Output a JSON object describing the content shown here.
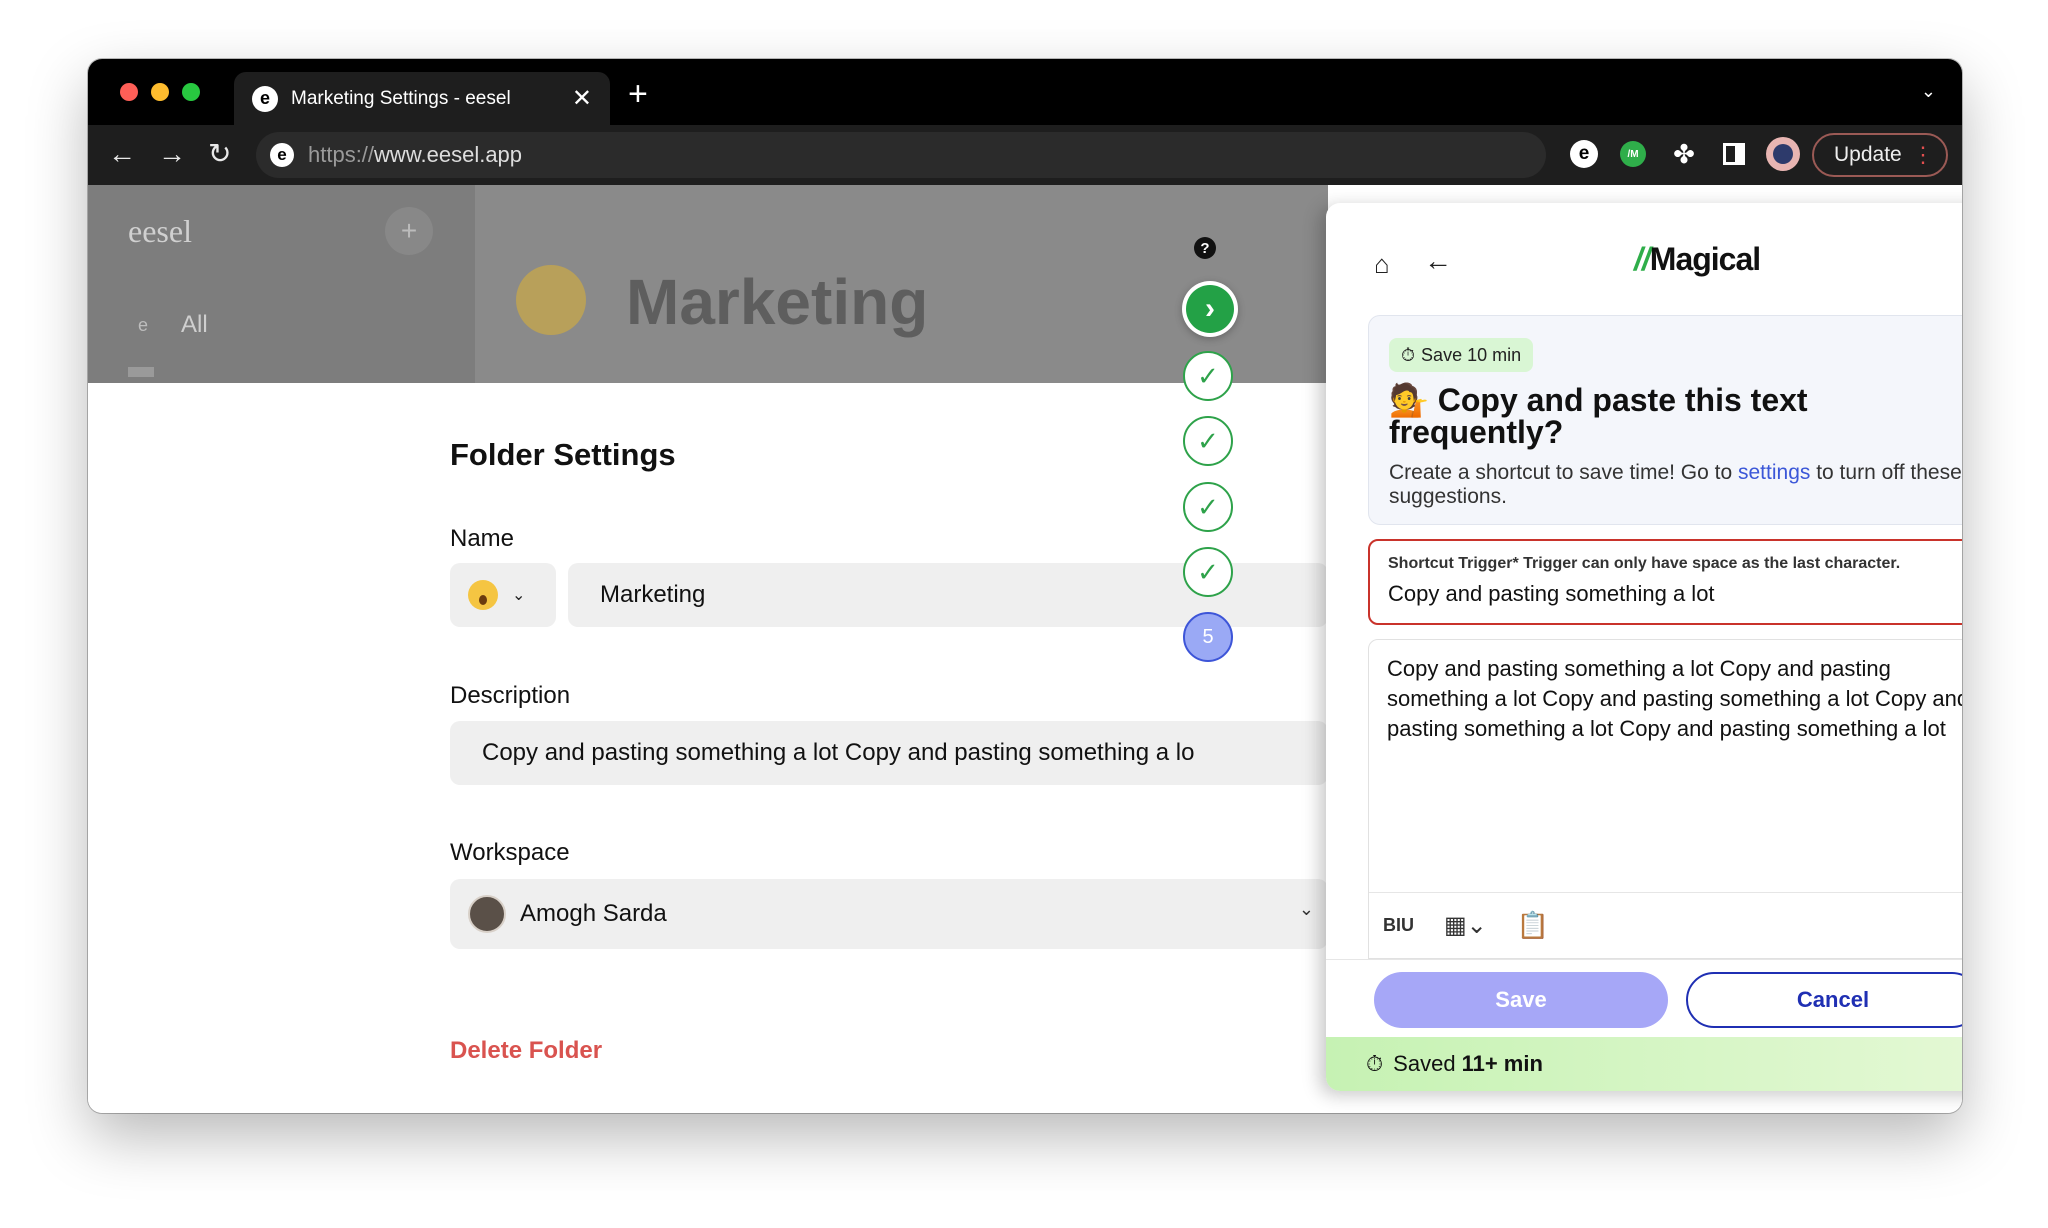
{
  "browser": {
    "tab_title": "Marketing Settings - eesel",
    "tab_favicon": "e",
    "url_scheme": "https://",
    "url_host": "www.eesel.app",
    "update_label": "Update",
    "ext_m_label": "/M"
  },
  "sidebar": {
    "logo": "eesel",
    "all_icon": "e",
    "all_label": "All"
  },
  "header": {
    "title": "Marketing"
  },
  "steps": {
    "current": "5"
  },
  "form": {
    "title": "Folder Settings",
    "name_label": "Name",
    "name_value": "Marketing",
    "description_label": "Description",
    "description_value": "Copy and pasting something a lot Copy and pasting something a lo",
    "workspace_label": "Workspace",
    "workspace_value": "Amogh Sarda",
    "delete_label": "Delete Folder"
  },
  "magical": {
    "logo_slash": "//",
    "logo_text": "Magical",
    "save_pill": "Save 10 min",
    "suggest_emoji": "💁",
    "suggest_title": "Copy and paste this text frequently?",
    "suggest_body_before": "Create a shortcut to save time! Go to ",
    "suggest_link": "settings",
    "suggest_body_after": " to turn off these suggestions.",
    "trigger_label": "Shortcut Trigger*  Trigger can only have space as the last character.",
    "trigger_value": "Copy and pasting something a lot",
    "editor_text": "Copy and pasting something a lot Copy and pasting something a lot Copy and pasting something a lot Copy and pasting something a lot Copy and pasting something a lot",
    "save_button": "Save",
    "cancel_button": "Cancel",
    "saved_prefix": "Saved",
    "saved_amount": "11+ min"
  }
}
